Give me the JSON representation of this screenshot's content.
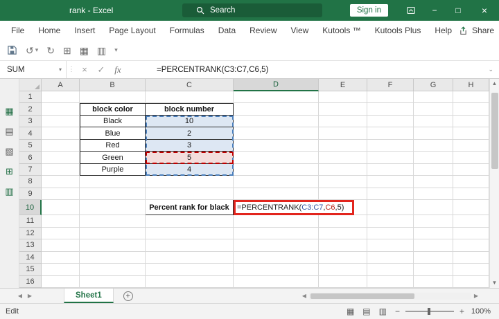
{
  "title_bar": {
    "title": "rank - Excel",
    "search_label": "Search",
    "sign_in_label": "Sign in"
  },
  "menu_bar": {
    "tabs": [
      "File",
      "Home",
      "Insert",
      "Page Layout",
      "Formulas",
      "Data",
      "Review",
      "View",
      "Kutools ™",
      "Kutools Plus",
      "Help"
    ],
    "share_label": "Share"
  },
  "formula_bar": {
    "name_box_value": "SUM",
    "fx_label": "fx",
    "formula": "=PERCENTRANK(C3:C7,C6,5)"
  },
  "grid": {
    "column_headers": [
      "A",
      "B",
      "C",
      "D",
      "E",
      "F",
      "G",
      "H"
    ],
    "row_headers": [
      "1",
      "2",
      "3",
      "4",
      "5",
      "6",
      "7",
      "8",
      "9",
      "10",
      "11",
      "12",
      "13",
      "14",
      "15",
      "16"
    ],
    "selected_column": "D",
    "selected_row": "10",
    "table": {
      "header_color": "block color",
      "header_number": "block number",
      "rows": [
        {
          "color": "Black",
          "number": "10"
        },
        {
          "color": "Blue",
          "number": "2"
        },
        {
          "color": "Red",
          "number": "3"
        },
        {
          "color": "Green",
          "number": "5"
        },
        {
          "color": "Purple",
          "number": "4"
        }
      ]
    },
    "label_cell": "Percent rank for black",
    "formula_cell": {
      "prefix": "=PERCENTRANK(",
      "range_ref": "C3:C7",
      "comma": ",",
      "cell_ref": "C6",
      "suffix": ",5)"
    }
  },
  "sheet_bar": {
    "tab": "Sheet1"
  },
  "status_bar": {
    "mode": "Edit",
    "zoom": "100%"
  },
  "colors": {
    "excel_green": "#217346",
    "range_fill": "#dde7f3",
    "range_border": "#4a7ebb",
    "ref_fill": "#f3dddc",
    "ref_border": "#c00000",
    "annotation_red": "#e2251d"
  },
  "icons": {
    "close": "×",
    "maximize": "□",
    "minimize": "−",
    "dropdown": "▾",
    "expand": "⌄",
    "cancel": "×",
    "enter": "✓",
    "dots": "⋮",
    "undo": "↺",
    "redo": "↻",
    "qat_1": "⊞",
    "qat_2": "▦",
    "qat_3": "▥",
    "strip_1": "▦",
    "strip_2": "▤",
    "strip_3": "▧",
    "strip_4": "⊞",
    "strip_5": "▥",
    "view_normal": "▦",
    "view_layout": "▤",
    "view_break": "▥",
    "nav_left": "◀",
    "nav_right": "▶",
    "scroll_up": "▲",
    "scroll_down": "▼",
    "add_sheet": "+",
    "zoom_out": "−",
    "zoom_in": "+"
  }
}
